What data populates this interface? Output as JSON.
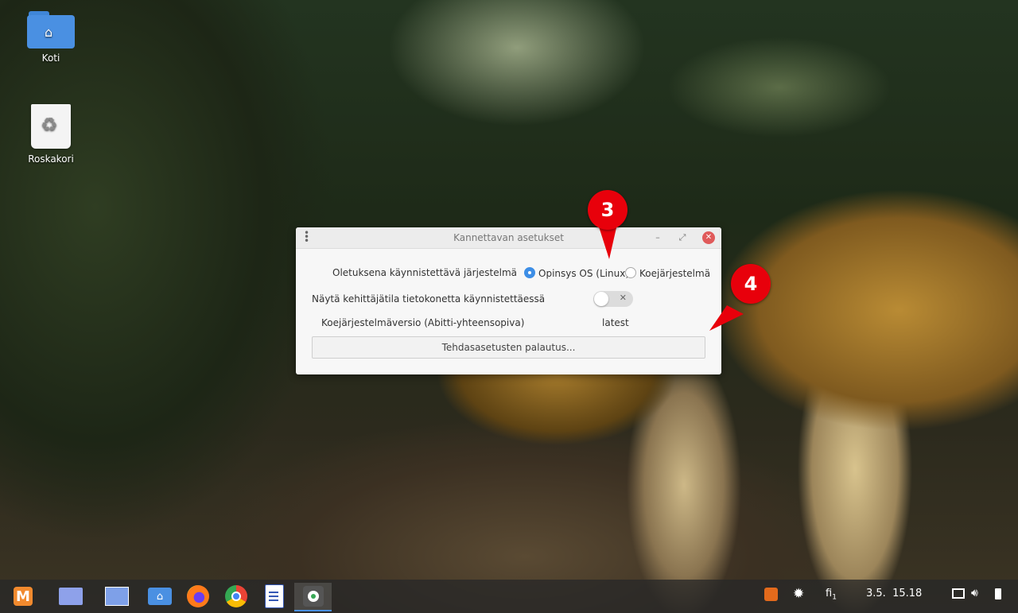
{
  "desktop": {
    "icons": [
      {
        "label": "Koti"
      },
      {
        "label": "Roskakori"
      }
    ]
  },
  "window": {
    "title": "Kannettavan asetukset",
    "default_os_label": "Oletuksena käynnistettävä järjestelmä",
    "os_options": [
      {
        "label": "Opinsys OS (Linux)",
        "selected": true
      },
      {
        "label": "Koejärjestelmä",
        "selected": false
      }
    ],
    "dev_mode_label": "Näytä kehittäjätila tietokonetta käynnistettäessä",
    "dev_mode_on": false,
    "exam_version_label": "Koejärjestelmäversio (Abitti-yhteensopiva)",
    "exam_version_value": "latest",
    "reset_button": "Tehdasasetusten palautus..."
  },
  "markers": [
    {
      "number": "3"
    },
    {
      "number": "4"
    }
  ],
  "taskbar": {
    "apps": [
      "menu-icon",
      "workspaces-icon",
      "window-switcher-icon",
      "files-icon",
      "firefox-icon",
      "chrome-icon",
      "text-editor-icon",
      "settings-app-icon"
    ],
    "tray": {
      "keyboard_layout": "fi",
      "keyboard_layout_index": "1",
      "clock": "3.5.  15.18"
    }
  },
  "colors": {
    "marker": "#e8000b",
    "accent": "#3d8ee6",
    "close_button": "#e05a5a"
  }
}
